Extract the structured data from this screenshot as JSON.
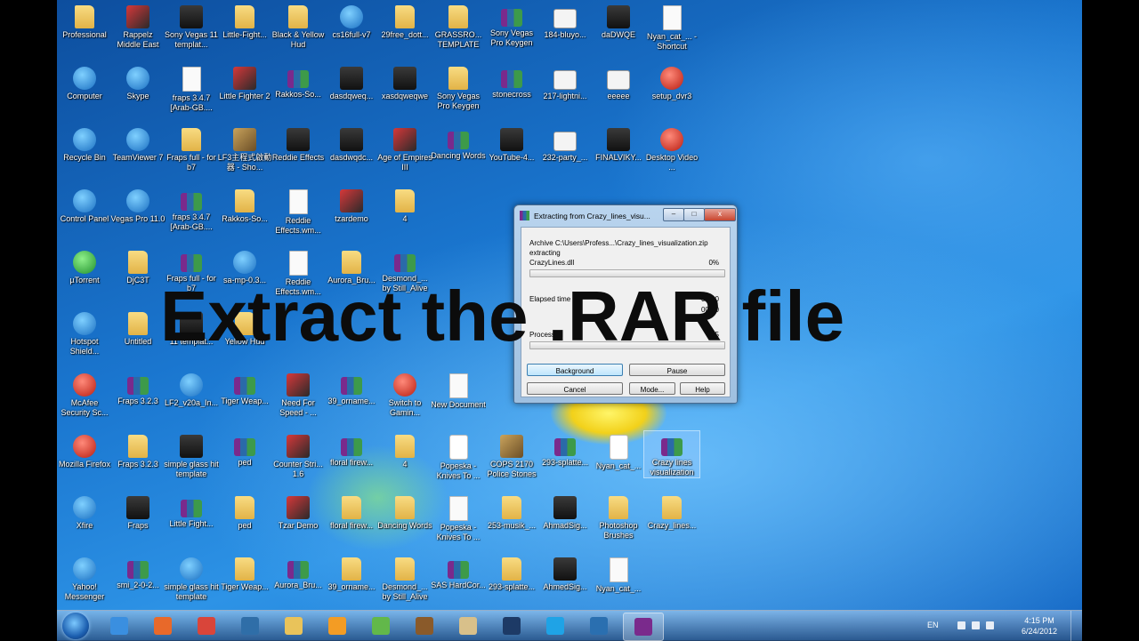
{
  "desktop": {
    "icons": [
      {
        "label": "Professional",
        "type": "folder"
      },
      {
        "label": "Rappelz Middle East",
        "type": "game"
      },
      {
        "label": "Sony Vegas 11 templat...",
        "type": "app"
      },
      {
        "label": "Little-Fight...",
        "type": "folder"
      },
      {
        "label": "Black & Yellow Hud",
        "type": "folder"
      },
      {
        "label": "cs16full-v7",
        "type": "blue"
      },
      {
        "label": "29free_dott...",
        "type": "folder"
      },
      {
        "label": "GRASSRO... TEMPLATE",
        "type": "folder"
      },
      {
        "label": "Sony Vegas Pro Keygen",
        "type": "rar"
      },
      {
        "label": "184-bluyo...",
        "type": "brush"
      },
      {
        "label": "daDWQE",
        "type": "app"
      },
      {
        "label": "Nyan_cat_... - Shortcut",
        "type": "doc"
      },
      {
        "label": "Computer",
        "type": "blue"
      },
      {
        "label": "Skype",
        "type": "blue"
      },
      {
        "label": "fraps 3.4.7 [Arab-GB....",
        "type": "doc"
      },
      {
        "label": "Little Fighter 2",
        "type": "game"
      },
      {
        "label": "Rakkos-So...",
        "type": "rar"
      },
      {
        "label": "dasdqweq...",
        "type": "app"
      },
      {
        "label": "xasdqweqwe",
        "type": "app"
      },
      {
        "label": "Sony Vegas Pro Keygen",
        "type": "folder"
      },
      {
        "label": "stonecross",
        "type": "rar"
      },
      {
        "label": "217-lightni...",
        "type": "brush"
      },
      {
        "label": "eeeee",
        "type": "brush"
      },
      {
        "label": "setup_dvr3",
        "type": "red"
      },
      {
        "label": "Recycle Bin",
        "type": "blue"
      },
      {
        "label": "TeamViewer 7",
        "type": "blue"
      },
      {
        "label": "Fraps full - for b7",
        "type": "folder"
      },
      {
        "label": "LF3主程式啟動器 - Sho...",
        "type": "img"
      },
      {
        "label": "Reddie Effects",
        "type": "app"
      },
      {
        "label": "dasdwqdc...",
        "type": "app"
      },
      {
        "label": "Age of Empires III",
        "type": "game"
      },
      {
        "label": "Dancing Words",
        "type": "rar"
      },
      {
        "label": "YouTube-4...",
        "type": "app"
      },
      {
        "label": "232-party_...",
        "type": "brush"
      },
      {
        "label": "FINALVIKY...",
        "type": "app"
      },
      {
        "label": "Desktop Video ...",
        "type": "red"
      },
      {
        "label": "Control Panel",
        "type": "blue"
      },
      {
        "label": "Vegas Pro 11.0",
        "type": "blue"
      },
      {
        "label": "fraps 3.4.7 [Arab-GB....",
        "type": "rar"
      },
      {
        "label": "Rakkos-So...",
        "type": "folder"
      },
      {
        "label": "Reddie Effects.wm...",
        "type": "doc"
      },
      {
        "label": "tzardemo",
        "type": "game"
      },
      {
        "label": "4",
        "type": "folder"
      },
      {
        "label": "µTorrent",
        "type": "green"
      },
      {
        "label": "DjC3T",
        "type": "folder"
      },
      {
        "label": "Fraps full - for b7",
        "type": "rar"
      },
      {
        "label": "sa-mp-0.3...",
        "type": "blue"
      },
      {
        "label": "Reddie Effects.wm...",
        "type": "doc"
      },
      {
        "label": "Aurora_Bru...",
        "type": "folder"
      },
      {
        "label": "Desmond_... by Still_Alive",
        "type": "rar"
      },
      {
        "label": "Hotspot Shield...",
        "type": "blue"
      },
      {
        "label": "Untitled",
        "type": "folder"
      },
      {
        "label": "11 templat...",
        "type": "app"
      },
      {
        "label": "Yellow Hud",
        "type": "folder"
      },
      {
        "label": "McAfee Security Sc...",
        "type": "red"
      },
      {
        "label": "Fraps 3.2.3",
        "type": "rar"
      },
      {
        "label": "LF2_v20a_In...",
        "type": "blue"
      },
      {
        "label": "Tiger Weap...",
        "type": "rar"
      },
      {
        "label": "Need For Speed - ...",
        "type": "game"
      },
      {
        "label": "39_orname...",
        "type": "rar"
      },
      {
        "label": "Switch to Gamin...",
        "type": "red"
      },
      {
        "label": "New Document",
        "type": "doc"
      },
      {
        "label": "Mozilla Firefox",
        "type": "red"
      },
      {
        "label": "Fraps 3.2.3",
        "type": "folder"
      },
      {
        "label": "simple glass hit template",
        "type": "app"
      },
      {
        "label": "ped",
        "type": "rar"
      },
      {
        "label": "Counter Stri... 1.6",
        "type": "game"
      },
      {
        "label": "floral firew...",
        "type": "rar"
      },
      {
        "label": "4",
        "type": "folder"
      },
      {
        "label": "Popeska - Knives To ...",
        "type": "mp3"
      },
      {
        "label": "COPS 2170 Police Stones",
        "type": "img"
      },
      {
        "label": "293-splatte...",
        "type": "rar"
      },
      {
        "label": "Nyan_cat_...",
        "type": "mp3"
      },
      {
        "label": "Crazy lines visualization",
        "type": "rar",
        "selected": true
      },
      {
        "label": "Xfire",
        "type": "blue"
      },
      {
        "label": "Fraps",
        "type": "app"
      },
      {
        "label": "Little Fight...",
        "type": "rar"
      },
      {
        "label": "ped",
        "type": "folder"
      },
      {
        "label": "Tzar Demo",
        "type": "game"
      },
      {
        "label": "floral firew...",
        "type": "folder"
      },
      {
        "label": "Dancing Words",
        "type": "folder"
      },
      {
        "label": "Popeska - Knives To ...",
        "type": "doc"
      },
      {
        "label": "253-musik_...",
        "type": "folder"
      },
      {
        "label": "AhmadSig...",
        "type": "app"
      },
      {
        "label": "Photoshop Brushes",
        "type": "folder"
      },
      {
        "label": "Crazy_lines...",
        "type": "folder"
      },
      {
        "label": "Yahoo! Messenger",
        "type": "blue"
      },
      {
        "label": "smi_2-0-2...",
        "type": "rar"
      },
      {
        "label": "simple glass hit template",
        "type": "blue"
      },
      {
        "label": "Tiger Weap...",
        "type": "folder"
      },
      {
        "label": "Aurora_Bru...",
        "type": "rar"
      },
      {
        "label": "39_orname...",
        "type": "folder"
      },
      {
        "label": "Desmond_... by Still_Alive",
        "type": "folder"
      },
      {
        "label": "SAS HardCor...",
        "type": "rar"
      },
      {
        "label": "293-splatte...",
        "type": "folder"
      },
      {
        "label": "AhmedSig...",
        "type": "app"
      },
      {
        "label": "Nyan_cat_...",
        "type": "doc"
      }
    ]
  },
  "dialog": {
    "title": "Extracting from Crazy_lines_visu...",
    "controls": {
      "minimize": "–",
      "maximize": "□",
      "close": "x"
    },
    "archive_line": "Archive C:\\Users\\Profess...\\Crazy_lines_visualization.zip",
    "status": "extracting",
    "current_file": "CrazyLines.dll",
    "file_percent": "0%",
    "elapsed_label": "Elapsed time",
    "time_1": "00:00",
    "time_2": "00:00",
    "processed_label": "Processed",
    "processed_value": "55",
    "buttons": {
      "background": "Background",
      "pause": "Pause",
      "cancel": "Cancel",
      "mode": "Mode...",
      "help": "Help"
    }
  },
  "caption": "Extract the .RAR file",
  "taskbar": {
    "apps": [
      {
        "name": "ie-icon",
        "color": "#3a8fe0"
      },
      {
        "name": "firefox-icon",
        "color": "#e8692a"
      },
      {
        "name": "chrome-icon",
        "color": "#d9453a"
      },
      {
        "name": "network-globe-icon",
        "color": "#2f6ea8"
      },
      {
        "name": "explorer-folder-icon",
        "color": "#e9c35a"
      },
      {
        "name": "media-player-icon",
        "color": "#f39c24"
      },
      {
        "name": "users-icon",
        "color": "#62b84a"
      },
      {
        "name": "game-icon",
        "color": "#8a5a2a"
      },
      {
        "name": "chess-icon",
        "color": "#d8c08a"
      },
      {
        "name": "photoshop-icon",
        "color": "#1d3a66"
      },
      {
        "name": "skype-icon",
        "color": "#1fa3e6"
      },
      {
        "name": "camtasia-icon",
        "color": "#2a6fb0"
      },
      {
        "name": "winrar-icon",
        "color": "#7a2a8c"
      }
    ],
    "language": "EN",
    "time": "4:15 PM",
    "date": "6/24/2012"
  }
}
